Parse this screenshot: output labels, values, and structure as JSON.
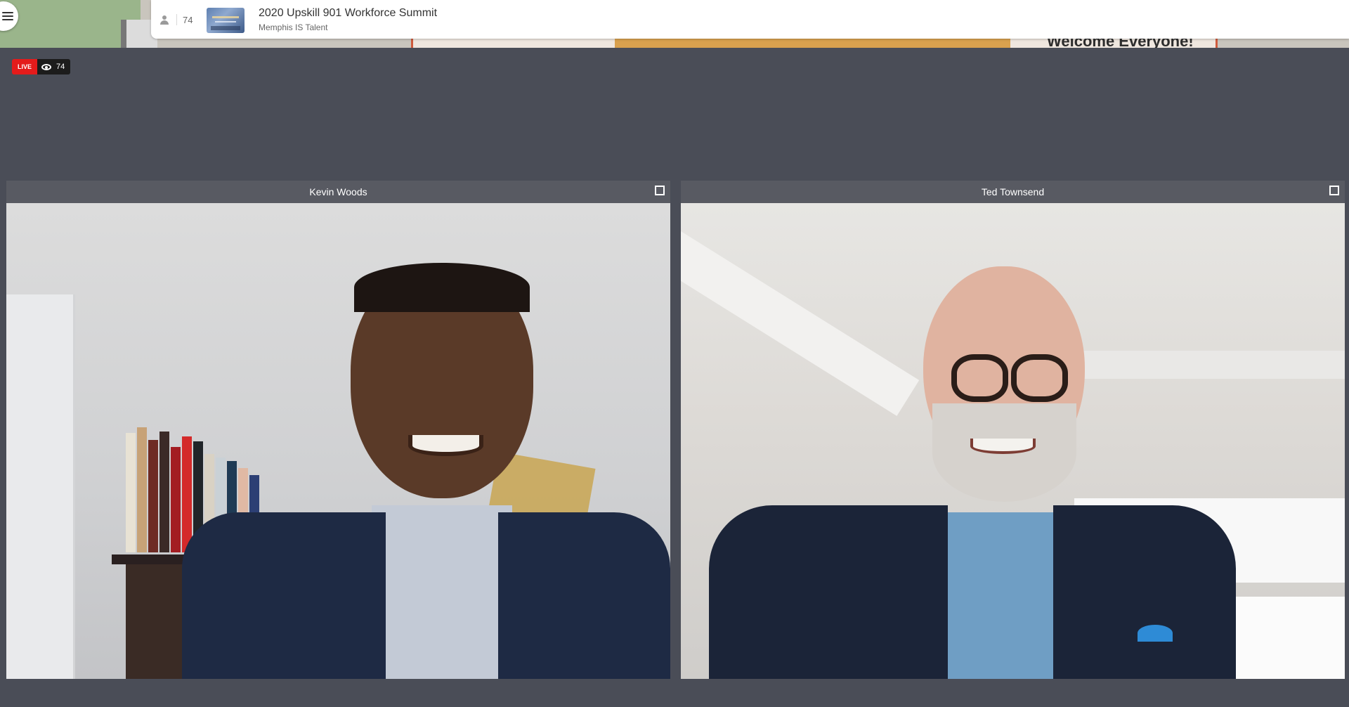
{
  "header": {
    "viewer_count": "74",
    "event_title": "2020 Upskill 901 Workforce Summit",
    "organizer": "Memphis IS Talent"
  },
  "background": {
    "banner_text": "Welcome Everyone!"
  },
  "live": {
    "label": "LIVE",
    "viewers": "74"
  },
  "tiles": [
    {
      "name": "Kevin Woods"
    },
    {
      "name": "Ted Townsend"
    }
  ],
  "colors": {
    "stage_bg": "#4a4d57",
    "live_red": "#e41b1b",
    "tile_bar": "#585a62"
  },
  "icons": [
    "menu-icon",
    "person-icon",
    "eye-icon",
    "expand-icon"
  ]
}
